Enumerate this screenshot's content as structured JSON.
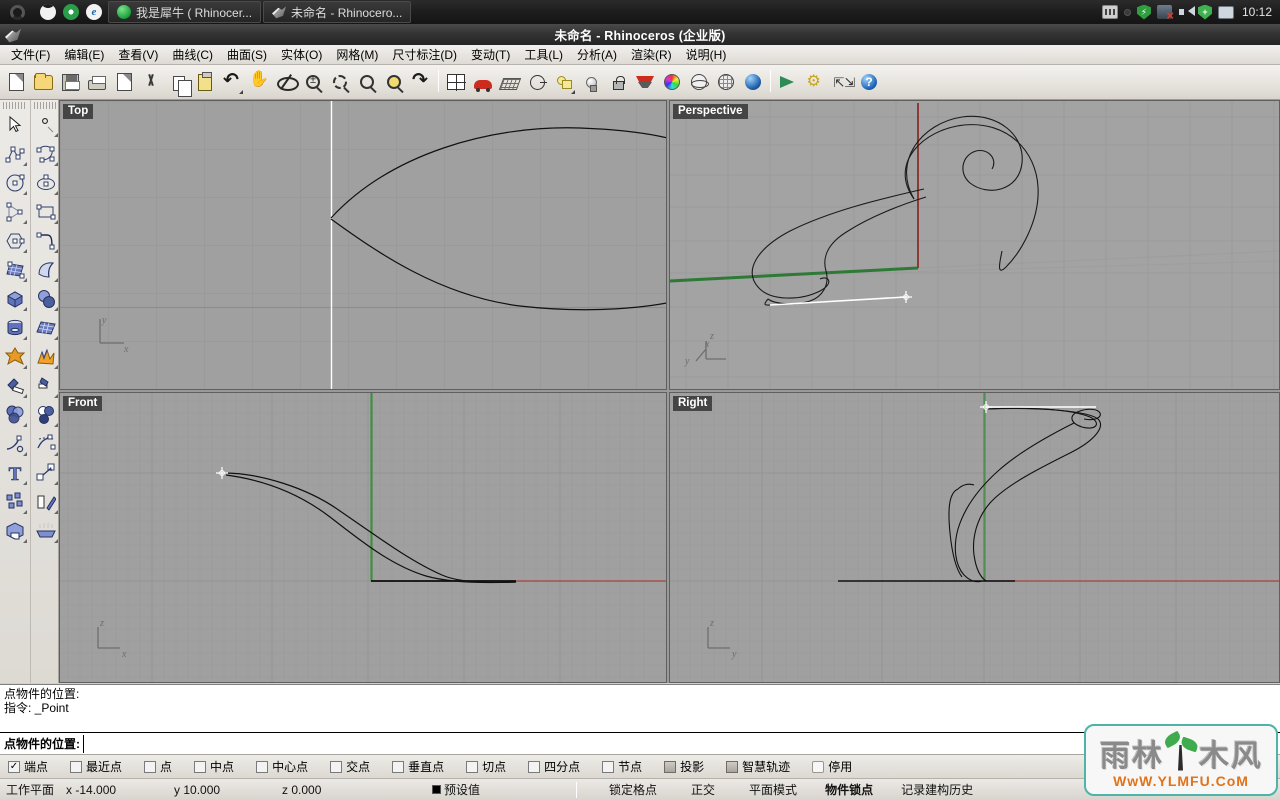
{
  "taskbar": {
    "quick_launch": [
      {
        "name": "moon-icon",
        "label": ""
      },
      {
        "name": "chrome-icon",
        "label": ""
      },
      {
        "name": "edge-icon",
        "label": "e"
      }
    ],
    "tasks": [
      {
        "icon": "rhino-tutorial-icon",
        "label": "我是犀牛 ( Rhinocer..."
      },
      {
        "icon": "rhino-app-icon",
        "label": "未命名 - Rhinocero..."
      }
    ],
    "tray": [
      "keyboard-icon",
      "hidden-icons-icon",
      "security-shield-icon",
      "network-disconnected-icon",
      "volume-icon",
      "update-shield-icon",
      "display-icon"
    ],
    "clock": "10:12"
  },
  "window": {
    "title": "未命名 - Rhinoceros (企业版)"
  },
  "menubar": [
    {
      "label": "文件(F)",
      "key": "F"
    },
    {
      "label": "编辑(E)",
      "key": "E"
    },
    {
      "label": "查看(V)",
      "key": "V"
    },
    {
      "label": "曲线(C)",
      "key": "C"
    },
    {
      "label": "曲面(S)",
      "key": "S"
    },
    {
      "label": "实体(O)",
      "key": "O"
    },
    {
      "label": "网格(M)",
      "key": "M"
    },
    {
      "label": "尺寸标注(D)",
      "key": "D"
    },
    {
      "label": "变动(T)",
      "key": "T"
    },
    {
      "label": "工具(L)",
      "key": "L"
    },
    {
      "label": "分析(A)",
      "key": "A"
    },
    {
      "label": "渲染(R)",
      "key": "R"
    },
    {
      "label": "说明(H)",
      "key": "H"
    }
  ],
  "toolbar": [
    {
      "name": "new-file-button",
      "icon": "new-file-icon"
    },
    {
      "name": "open-file-button",
      "icon": "open-folder-icon"
    },
    {
      "name": "save-file-button",
      "icon": "save-disk-icon"
    },
    {
      "name": "print-button",
      "icon": "printer-icon"
    },
    {
      "name": "cut-plane-button",
      "icon": "page-arrow-icon"
    },
    {
      "name": "cut-button",
      "icon": "scissors-icon"
    },
    {
      "name": "copy-button",
      "icon": "copy-pages-icon"
    },
    {
      "name": "paste-button",
      "icon": "clipboard-icon"
    },
    {
      "name": "undo-button",
      "icon": "undo-arrow-icon"
    },
    {
      "name": "pan-button",
      "icon": "hand-icon"
    },
    {
      "name": "rotate-view-button",
      "icon": "gumball-orbit-icon"
    },
    {
      "name": "zoom-dynamic-button",
      "icon": "zoom-plusminus-icon"
    },
    {
      "name": "zoom-window-button",
      "icon": "zoom-window-icon"
    },
    {
      "name": "zoom-extents-button",
      "icon": "zoom-extents-icon"
    },
    {
      "name": "zoom-selected-button",
      "icon": "zoom-selected-icon"
    },
    {
      "name": "undo-view-button",
      "icon": "undo-view-icon"
    },
    {
      "name": "four-viewport-button",
      "icon": "four-view-icon"
    },
    {
      "name": "named-views-button",
      "icon": "car-perspective-icon"
    },
    {
      "name": "grid-button",
      "icon": "grid-plane-icon"
    },
    {
      "name": "object-properties-button",
      "icon": "circle-dot-icon"
    },
    {
      "name": "layers-button",
      "icon": "layer-icon"
    },
    {
      "name": "lights-button",
      "icon": "light-bulb-icon"
    },
    {
      "name": "lock-button",
      "icon": "lock-icon"
    },
    {
      "name": "shade-button",
      "icon": "shade-view-icon"
    },
    {
      "name": "color-button",
      "icon": "color-wheel-icon"
    },
    {
      "name": "wireframe-button",
      "icon": "wireframe-sphere-icon"
    },
    {
      "name": "ghosted-button",
      "icon": "ghosted-sphere-icon"
    },
    {
      "name": "rendered-button",
      "icon": "rendered-sphere-icon"
    },
    {
      "name": "render-button",
      "icon": "render-triangle-icon"
    },
    {
      "name": "options-button",
      "icon": "gears-icon"
    },
    {
      "name": "dimension-button",
      "icon": "dimension-icon"
    },
    {
      "name": "help-button",
      "icon": "help-icon"
    }
  ],
  "sidebar": {
    "left_column": [
      {
        "name": "select-tool",
        "icon": "arrow-cursor-icon"
      },
      {
        "name": "polyline-tool",
        "icon": "polyline-icon"
      },
      {
        "name": "circle-tool",
        "icon": "circle-icon"
      },
      {
        "name": "arc-tool",
        "icon": "arc-triangle-icon"
      },
      {
        "name": "polygon-tool",
        "icon": "polygon-icon"
      },
      {
        "name": "surface-from-points-tool",
        "icon": "surface-patch-icon"
      },
      {
        "name": "box-tool",
        "icon": "box-icon"
      },
      {
        "name": "cylinder-tool",
        "icon": "cylinder-icon"
      },
      {
        "name": "boolean-union-tool",
        "icon": "boolean-union-icon"
      },
      {
        "name": "trim-tool",
        "icon": "trim-icon"
      },
      {
        "name": "boolean-tools",
        "icon": "three-circles-icon"
      },
      {
        "name": "fillet-curve-tool",
        "icon": "fillet-curve-icon"
      },
      {
        "name": "text-tool",
        "icon": "text-icon"
      },
      {
        "name": "array-tool",
        "icon": "array-icon"
      },
      {
        "name": "render-tools",
        "icon": "render-box-icon"
      }
    ],
    "right_column": [
      {
        "name": "point-tool",
        "icon": "point-icon"
      },
      {
        "name": "control-point-curve-tool",
        "icon": "control-point-curve-icon"
      },
      {
        "name": "ellipse-tool",
        "icon": "ellipse-icon"
      },
      {
        "name": "rectangle-tool",
        "icon": "rectangle-icon"
      },
      {
        "name": "curve-corner-tool",
        "icon": "corner-curve-icon"
      },
      {
        "name": "extrude-surface-tool",
        "icon": "extrude-surface-icon"
      },
      {
        "name": "sphere-tool",
        "icon": "spheres-icon"
      },
      {
        "name": "mesh-tool",
        "icon": "mesh-plane-icon"
      },
      {
        "name": "explode-tool",
        "icon": "explode-icon"
      },
      {
        "name": "split-tool",
        "icon": "split-icon"
      },
      {
        "name": "offset-tools",
        "icon": "circles-offset-icon"
      },
      {
        "name": "curve-from-objects-tool",
        "icon": "dashed-curve-icon"
      },
      {
        "name": "transform-tool",
        "icon": "transform-arrow-icon"
      },
      {
        "name": "mirror-tool",
        "icon": "mirror-icon"
      },
      {
        "name": "lighting-tool",
        "icon": "lights-row-icon"
      }
    ]
  },
  "viewports": [
    {
      "name": "viewport-top",
      "label": "Top",
      "axis": [
        "y",
        "x"
      ]
    },
    {
      "name": "viewport-perspective",
      "label": "Perspective",
      "axis": [
        "z",
        "x",
        "y"
      ]
    },
    {
      "name": "viewport-front",
      "label": "Front",
      "axis": [
        "z",
        "x"
      ]
    },
    {
      "name": "viewport-right",
      "label": "Right",
      "axis": [
        "z",
        "y"
      ]
    }
  ],
  "command": {
    "history": [
      "点物件的位置:",
      "指令: _Point"
    ],
    "prompt_label": "点物件的位置:",
    "input_value": "",
    "input_placeholder": ""
  },
  "osnap": [
    {
      "label": "端点",
      "type": "checkbox",
      "checked": true
    },
    {
      "label": "最近点",
      "type": "checkbox",
      "checked": false
    },
    {
      "label": "点",
      "type": "checkbox",
      "checked": false
    },
    {
      "label": "中点",
      "type": "checkbox",
      "checked": false
    },
    {
      "label": "中心点",
      "type": "checkbox",
      "checked": false
    },
    {
      "label": "交点",
      "type": "checkbox",
      "checked": false
    },
    {
      "label": "垂直点",
      "type": "checkbox",
      "checked": false
    },
    {
      "label": "切点",
      "type": "checkbox",
      "checked": false
    },
    {
      "label": "四分点",
      "type": "checkbox",
      "checked": false
    },
    {
      "label": "节点",
      "type": "checkbox",
      "checked": false
    },
    {
      "label": "投影",
      "type": "button",
      "checked": false
    },
    {
      "label": "智慧轨迹",
      "type": "button",
      "checked": false
    },
    {
      "label": "停用",
      "type": "plain",
      "checked": false
    }
  ],
  "statusbar": {
    "cplane_label": "工作平面",
    "x": "x -14.000",
    "y": "y 10.000",
    "z": "z 0.000",
    "layer": "预设值",
    "toggles": [
      {
        "label": "锁定格点",
        "active": false
      },
      {
        "label": "正交",
        "active": false
      },
      {
        "label": "平面模式",
        "active": false
      },
      {
        "label": "物件锁点",
        "active": true
      },
      {
        "label": "记录建构历史",
        "active": false
      }
    ]
  },
  "watermark": {
    "chars": [
      "雨",
      "林",
      "木",
      "风"
    ],
    "url": "WwW.YLMFU.CoM",
    "accent": "#4fb3a8",
    "url_color": "#e2731a",
    "leaf_color": "#3faa4e"
  }
}
